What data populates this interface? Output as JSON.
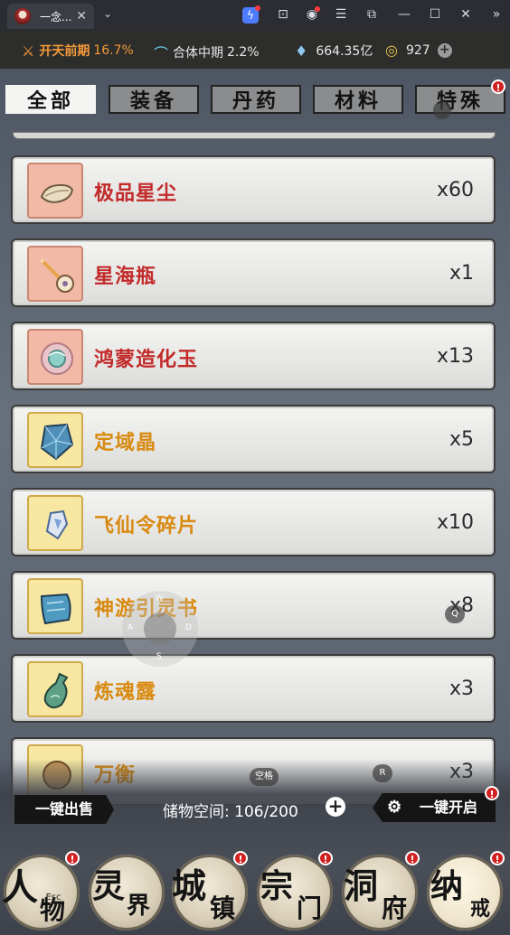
{
  "window": {
    "tab_title": "一念...",
    "tab_close": "✕",
    "dropdown": "⌄",
    "toolbar_icons": [
      "bolt-icon",
      "gift-icon",
      "account-icon",
      "menu-icon",
      "pin-icon",
      "minimize-icon",
      "maximize-icon",
      "close-icon",
      "expand-icon"
    ],
    "toolbar_glyphs": {
      "menu": "☰",
      "minimize": "—",
      "maximize": "☐",
      "close": "✕",
      "expand": "»",
      "gift": "⊡",
      "account": "◉",
      "pin": "⧉",
      "bolt": "ϟ"
    }
  },
  "resources": [
    {
      "icon": "sword-icon",
      "glyph": "⚔",
      "label": "开天前期",
      "value": "16.7%"
    },
    {
      "icon": "fan-icon",
      "glyph": "⌒",
      "label": "合体中期",
      "value": "2.2%"
    },
    {
      "icon": "crystal-icon",
      "glyph": "♦",
      "label": "",
      "value": "664.35亿"
    },
    {
      "icon": "coin-icon",
      "glyph": "◎",
      "label": "",
      "value": "927"
    }
  ],
  "resource_plus": "+",
  "category_tabs": [
    {
      "label": "全部",
      "active": true
    },
    {
      "label": "装备",
      "active": false
    },
    {
      "label": "丹药",
      "active": false
    },
    {
      "label": "材料",
      "active": false
    },
    {
      "label": "特殊",
      "active": false,
      "badge": "!"
    }
  ],
  "items": [
    {
      "name": "极品星尘",
      "count": "x60",
      "rarity": "red",
      "icon": "stardust-icon"
    },
    {
      "name": "星海瓶",
      "count": "x1",
      "rarity": "red",
      "icon": "star-bottle-icon"
    },
    {
      "name": "鸿蒙造化玉",
      "count": "x13",
      "rarity": "red",
      "icon": "jade-icon"
    },
    {
      "name": "定域晶",
      "count": "x5",
      "rarity": "gold",
      "icon": "crystal-shard-icon"
    },
    {
      "name": "飞仙令碎片",
      "count": "x10",
      "rarity": "gold",
      "icon": "token-fragment-icon"
    },
    {
      "name": "神游引灵书",
      "count": "x8",
      "rarity": "gold",
      "icon": "scroll-icon"
    },
    {
      "name": "炼魂露",
      "count": "x3",
      "rarity": "gold",
      "icon": "potion-icon"
    },
    {
      "name": "万衡",
      "count": "x3",
      "rarity": "gold",
      "icon": "partial-item-icon"
    }
  ],
  "footer": {
    "sell_all": "一键出售",
    "storage_label": "储物空间:",
    "storage_value": "106/200",
    "storage_plus": "+",
    "open_all": "一键开启",
    "open_gear": "⚙"
  },
  "nav": [
    {
      "c1": "人",
      "c2": "物",
      "badge": "!"
    },
    {
      "c1": "灵",
      "c2": "界",
      "badge": ""
    },
    {
      "c1": "城",
      "c2": "镇",
      "badge": "!"
    },
    {
      "c1": "宗",
      "c2": "门",
      "badge": "!"
    },
    {
      "c1": "洞",
      "c2": "府",
      "badge": "!"
    },
    {
      "c1": "纳",
      "c2": "戒",
      "badge": "!"
    }
  ],
  "overlay_keys": {
    "esc": "Esc",
    "space": "空格",
    "r": "R",
    "q": "Q",
    "w": "W",
    "a": "A",
    "s": "S",
    "d": "D"
  },
  "colors": {
    "red_text": "#c22a2a",
    "gold_text": "#d98a10",
    "resource_label": "#f39a3a",
    "badge": "#d21f1f"
  }
}
